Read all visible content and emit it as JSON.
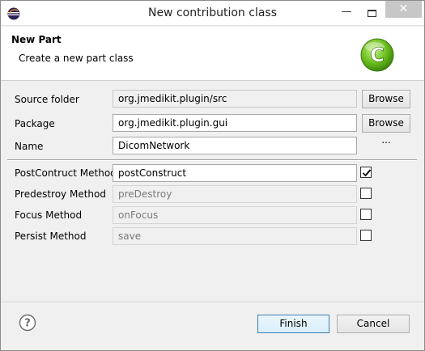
{
  "window": {
    "title": "New contribution class",
    "minimize_glyph": "—",
    "close_glyph": "✕"
  },
  "header": {
    "title": "New Part",
    "description": "Create a new part class",
    "logo_letter": "C"
  },
  "form": {
    "source_folder": {
      "label": "Source folder",
      "value": "org.jmedikit.plugin/src",
      "browse_label": "Browse ..."
    },
    "package": {
      "label": "Package",
      "value": "org.jmedikit.plugin.gui",
      "browse_label": "Browse ..."
    },
    "name": {
      "label": "Name",
      "value": "DicomNetwork"
    }
  },
  "methods": [
    {
      "label": "PostContruct Method",
      "value": "postConstruct",
      "checked": true,
      "enabled": true
    },
    {
      "label": "Predestroy Method",
      "value": "preDestroy",
      "checked": false,
      "enabled": false
    },
    {
      "label": "Focus Method",
      "value": "onFocus",
      "checked": false,
      "enabled": false
    },
    {
      "label": "Persist Method",
      "value": "save",
      "checked": false,
      "enabled": false
    }
  ],
  "footer": {
    "help_glyph": "?",
    "finish_label": "Finish",
    "cancel_label": "Cancel"
  },
  "colors": {
    "accent": "#3c7fb1",
    "logo_green": "#6cbf1f",
    "close_button": "#c7c7c7"
  }
}
